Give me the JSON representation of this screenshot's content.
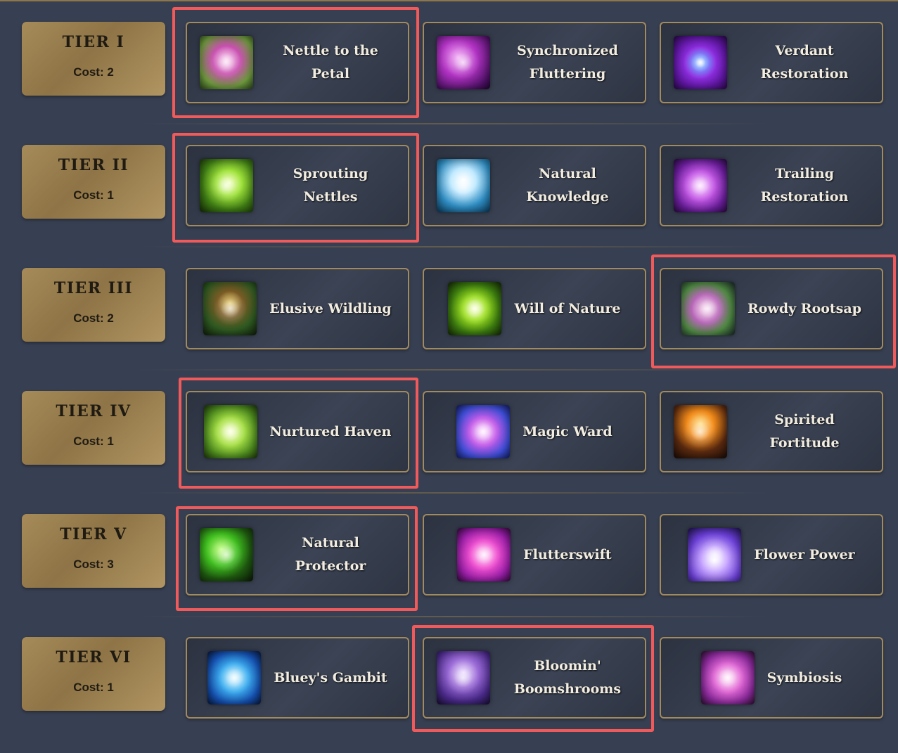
{
  "colors": {
    "background": "#373f52",
    "tier_badge": "#9a7f4f",
    "card_border": "#a08a5e",
    "highlight": "#f05a5a",
    "label": "#f2ede0"
  },
  "tiers": [
    {
      "name": "TIER I",
      "cost": "Cost: 2",
      "talents": [
        {
          "label": "Nettle to the Petal",
          "icon": "pink-flower-bud-icon",
          "selected": true
        },
        {
          "label": "Synchronized Fluttering",
          "icon": "purple-butterfly-wing-icon",
          "selected": false
        },
        {
          "label": "Verdant Restoration",
          "icon": "blue-purple-vortex-icon",
          "selected": false
        }
      ]
    },
    {
      "name": "TIER II",
      "cost": "Cost: 1",
      "talents": [
        {
          "label": "Sprouting Nettles",
          "icon": "green-thorn-bolt-icon",
          "selected": true
        },
        {
          "label": "Natural Knowledge",
          "icon": "white-tree-roots-icon",
          "selected": false
        },
        {
          "label": "Trailing Restoration",
          "icon": "purple-glowing-hands-icon",
          "selected": false
        }
      ]
    },
    {
      "name": "TIER III",
      "cost": "Cost: 2",
      "talents": [
        {
          "label": "Elusive Wildling",
          "icon": "eyes-in-grass-icon",
          "selected": false
        },
        {
          "label": "Will of Nature",
          "icon": "green-swirl-icon",
          "selected": false
        },
        {
          "label": "Rowdy Rootsap",
          "icon": "thorny-vine-icon",
          "selected": true
        }
      ]
    },
    {
      "name": "TIER IV",
      "cost": "Cost: 1",
      "talents": [
        {
          "label": "Nurtured Haven",
          "icon": "green-light-streaks-icon",
          "selected": true
        },
        {
          "label": "Magic Ward",
          "icon": "magic-scroll-icon",
          "selected": false
        },
        {
          "label": "Spirited Fortitude",
          "icon": "burning-figure-icon",
          "selected": false
        }
      ]
    },
    {
      "name": "TIER V",
      "cost": "Cost: 3",
      "talents": [
        {
          "label": "Natural Protector",
          "icon": "green-leaping-guardian-icon",
          "selected": true
        },
        {
          "label": "Flutterswift",
          "icon": "pink-spiral-icon",
          "selected": false
        },
        {
          "label": "Flower Power",
          "icon": "glowing-flower-icon",
          "selected": false
        }
      ]
    },
    {
      "name": "TIER VI",
      "cost": "Cost: 1",
      "talents": [
        {
          "label": "Bluey's Gambit",
          "icon": "blue-butterflies-icon",
          "selected": false
        },
        {
          "label": "Bloomin' Boomshrooms",
          "icon": "purple-mushroom-icon",
          "selected": true
        },
        {
          "label": "Symbiosis",
          "icon": "magenta-swirl-icon",
          "selected": false
        }
      ]
    }
  ]
}
